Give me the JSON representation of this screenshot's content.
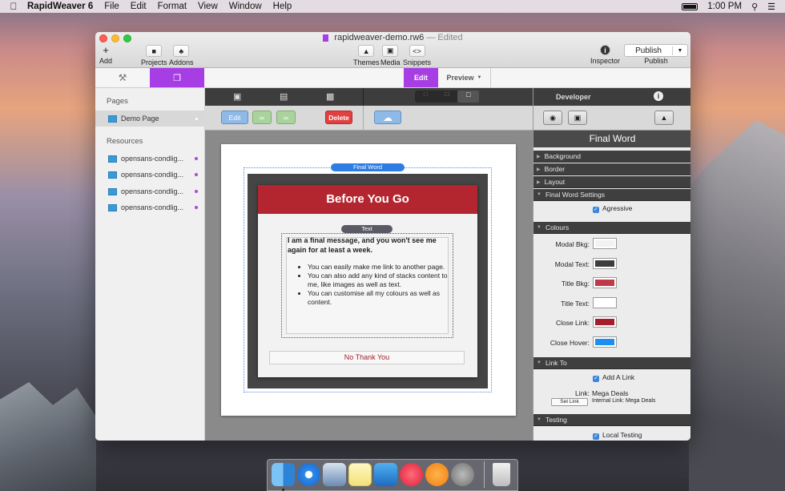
{
  "menubar": {
    "app": "RapidWeaver 6",
    "menus": [
      "File",
      "Edit",
      "Format",
      "View",
      "Window",
      "Help"
    ],
    "clock": "1:00 PM"
  },
  "window": {
    "filename": "rapidweaver-demo.rw6",
    "edited": "— Edited"
  },
  "toolbar": {
    "add": "Add",
    "projects": "Projects",
    "addons": "Addons",
    "themes": "Themes",
    "media": "Media",
    "snippets": "Snippets",
    "inspector": "Inspector",
    "publish_btn": "Publish",
    "publish": "Publish"
  },
  "modebar": {
    "edit": "Edit",
    "preview": "Preview"
  },
  "sidebar": {
    "pages_header": "Pages",
    "page": "Demo Page",
    "resources_header": "Resources",
    "resources": [
      "opensans-condlig...",
      "opensans-condlig...",
      "opensans-condlig...",
      "opensans-condlig..."
    ]
  },
  "editor": {
    "edit_btn": "Edit",
    "delete_btn": "Delete",
    "modal": {
      "stack_label": "Final Word",
      "title": "Before You Go",
      "text_label": "Text",
      "message": "I am a final message, and you won't see me again for at least a week.",
      "bullets": [
        "You can easily make me link to another page.",
        "You can also add any kind of stacks content to me, like images as well as text.",
        "You can customise all my colours as well as content."
      ],
      "button": "No Thank You"
    }
  },
  "inspector": {
    "developer": "Developer",
    "title": "Final Word",
    "sections": {
      "background": "Background",
      "border": "Border",
      "layout": "Layout",
      "settings": "Final Word Settings",
      "colours": "Colours",
      "link_to": "Link To",
      "testing": "Testing"
    },
    "agressive": "Agressive",
    "colours": [
      {
        "label": "Modal Bkg:",
        "color": "#f2f2f2"
      },
      {
        "label": "Modal Text:",
        "color": "#3c3c3c"
      },
      {
        "label": "Title Bkg:",
        "color": "#c0394a"
      },
      {
        "label": "Title Text:",
        "color": "#ffffff"
      },
      {
        "label": "Close Link:",
        "color": "#a31d2c"
      },
      {
        "label": "Close Hover:",
        "color": "#1e8ff0"
      }
    ],
    "add_link": "Add A Link",
    "link_label": "Link:",
    "link_value": "Mega Deals",
    "set_link": "Set Link",
    "internal_link": "Internal Link: Mega Deals",
    "local_testing": "Local Testing"
  },
  "colors": {
    "accent": "#a73de4",
    "title_bkg": "#b3262f"
  }
}
